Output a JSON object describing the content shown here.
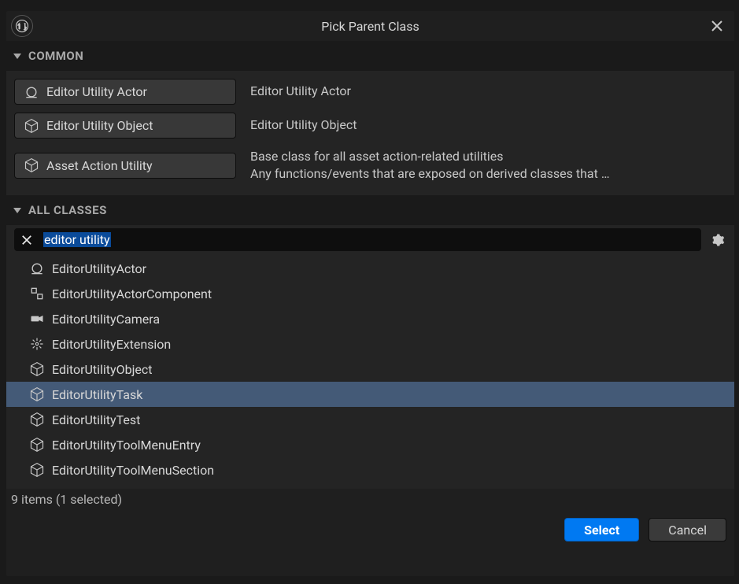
{
  "titlebar": {
    "title": "Pick Parent Class"
  },
  "sections": {
    "common": {
      "label": "COMMON"
    },
    "all_classes": {
      "label": "ALL CLASSES"
    }
  },
  "common_items": [
    {
      "label": "Editor Utility Actor",
      "desc": "Editor Utility Actor",
      "icon": "actor-sphere-icon"
    },
    {
      "label": "Editor Utility Object",
      "desc": "Editor Utility Object",
      "icon": "cube-icon"
    },
    {
      "label": "Asset Action Utility",
      "desc": "Base class for all asset action-related utilities\nAny functions/events that are exposed on derived classes that …",
      "icon": "cube-icon"
    }
  ],
  "search": {
    "value": "editor utility"
  },
  "class_items": [
    {
      "label": "EditorUtilityActor",
      "icon": "actor-sphere-icon",
      "selected": false
    },
    {
      "label": "EditorUtilityActorComponent",
      "icon": "component-icon",
      "selected": false
    },
    {
      "label": "EditorUtilityCamera",
      "icon": "camera-icon",
      "selected": false
    },
    {
      "label": "EditorUtilityExtension",
      "icon": "extension-icon",
      "selected": false
    },
    {
      "label": "EditorUtilityObject",
      "icon": "cube-icon",
      "selected": false
    },
    {
      "label": "EditorUtilityTask",
      "icon": "cube-icon",
      "selected": true
    },
    {
      "label": "EditorUtilityTest",
      "icon": "cube-icon",
      "selected": false
    },
    {
      "label": "EditorUtilityToolMenuEntry",
      "icon": "cube-icon",
      "selected": false
    },
    {
      "label": "EditorUtilityToolMenuSection",
      "icon": "cube-icon",
      "selected": false
    }
  ],
  "status": {
    "text": "9 items (1 selected)"
  },
  "buttons": {
    "select": "Select",
    "cancel": "Cancel"
  }
}
